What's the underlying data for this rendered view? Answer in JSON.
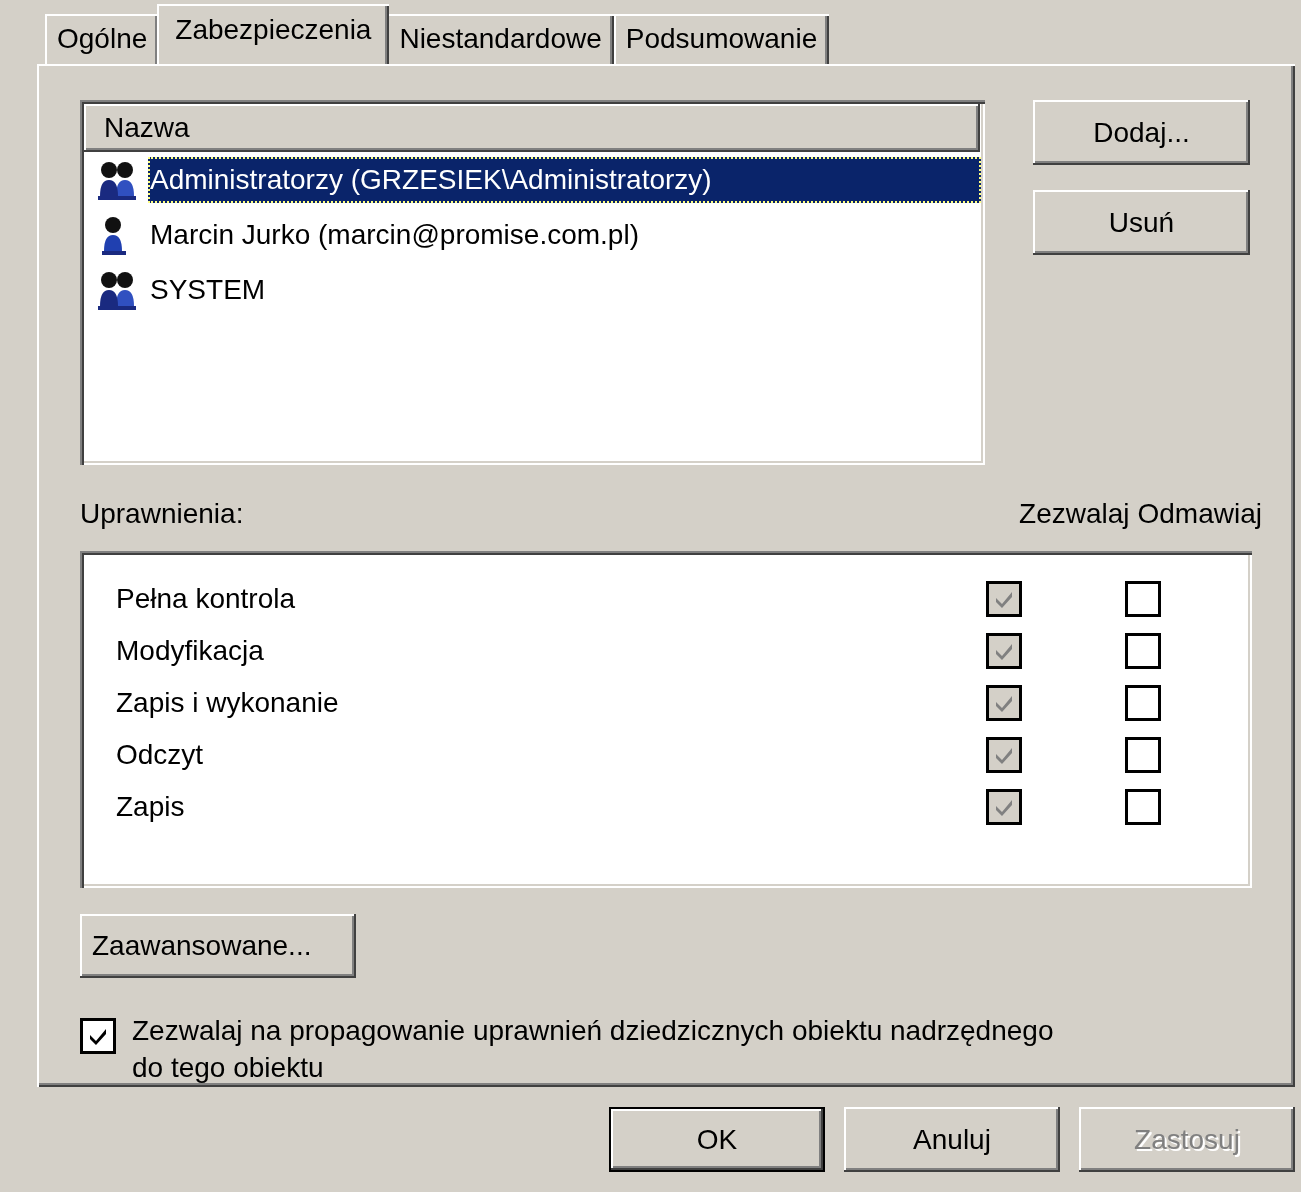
{
  "tabs": [
    {
      "label": "Ogólne",
      "selected": false
    },
    {
      "label": "Zabezpieczenia",
      "selected": true
    },
    {
      "label": "Niestandardowe",
      "selected": false
    },
    {
      "label": "Podsumowanie",
      "selected": false
    }
  ],
  "accounts": {
    "column": "Nazwa",
    "rows": [
      {
        "name": "Administratorzy (GRZESIEK\\Administratorzy)",
        "kind": "group",
        "selected": true
      },
      {
        "name": "Marcin Jurko (marcin@promise.com.pl)",
        "kind": "user",
        "selected": false
      },
      {
        "name": "SYSTEM",
        "kind": "group",
        "selected": false
      }
    ]
  },
  "side_buttons": [
    {
      "label": "Dodaj..."
    },
    {
      "label": "Usuń"
    }
  ],
  "permissions": {
    "label": "Uprawnienia:",
    "columns": [
      "Zezwalaj",
      "Odmawiaj"
    ],
    "rows": [
      {
        "name": "Pełna kontrola",
        "allow": {
          "checked": true,
          "disabled": true
        },
        "deny": {
          "checked": false,
          "disabled": false
        }
      },
      {
        "name": "Modyfikacja",
        "allow": {
          "checked": true,
          "disabled": true
        },
        "deny": {
          "checked": false,
          "disabled": false
        }
      },
      {
        "name": "Zapis i wykonanie",
        "allow": {
          "checked": true,
          "disabled": true
        },
        "deny": {
          "checked": false,
          "disabled": false
        }
      },
      {
        "name": "Odczyt",
        "allow": {
          "checked": true,
          "disabled": true
        },
        "deny": {
          "checked": false,
          "disabled": false
        }
      },
      {
        "name": "Zapis",
        "allow": {
          "checked": true,
          "disabled": true
        },
        "deny": {
          "checked": false,
          "disabled": false
        }
      }
    ]
  },
  "advanced_button": {
    "label": "Zaawansowane..."
  },
  "inherit": {
    "checked": true,
    "label_lines": [
      "Zezwalaj na propagowanie uprawnień dziedzicznych obiektu nadrzędnego",
      "do tego obiektu"
    ]
  },
  "footer_buttons": [
    {
      "label": "OK",
      "default": true,
      "disabled": false
    },
    {
      "label": "Anuluj",
      "default": false,
      "disabled": false
    },
    {
      "label": "Zastosuj",
      "default": false,
      "disabled": true
    }
  ]
}
